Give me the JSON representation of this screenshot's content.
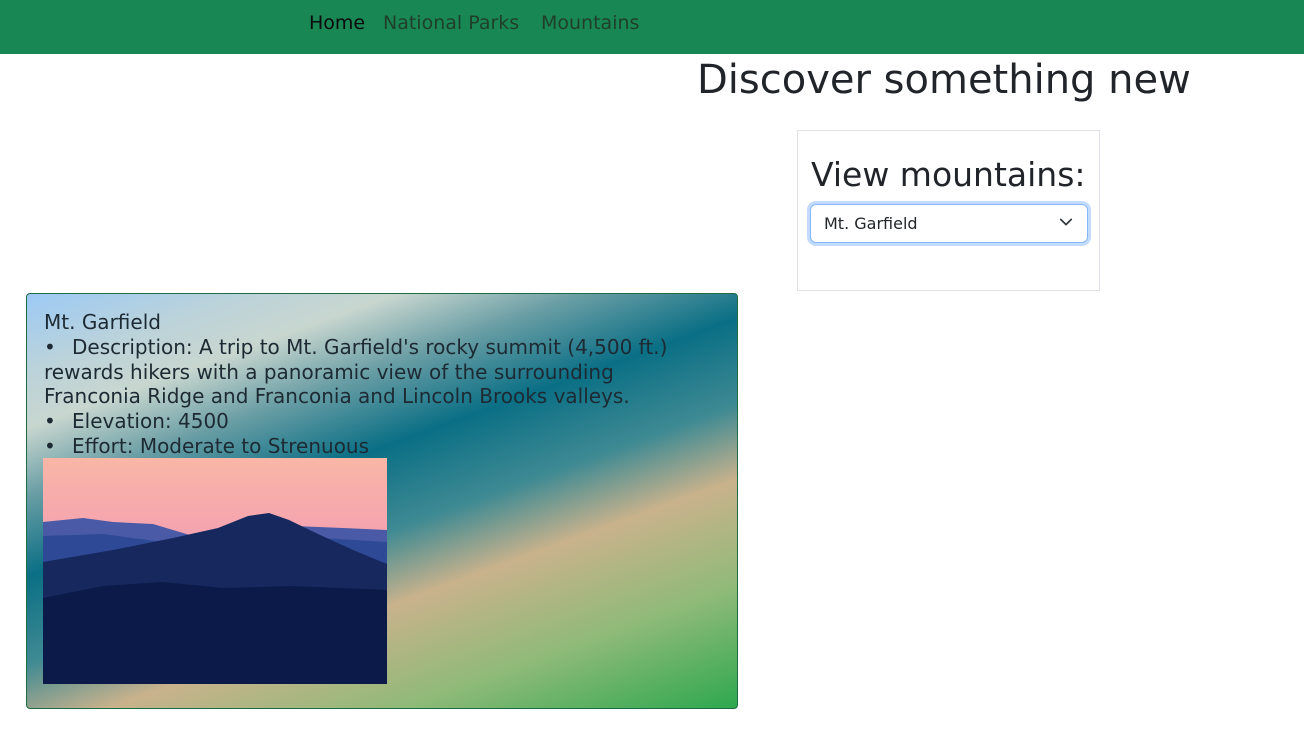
{
  "nav": {
    "items": [
      {
        "label": "Home"
      },
      {
        "label": "National Parks"
      },
      {
        "label": "Mountains"
      }
    ]
  },
  "heading": "Discover something new",
  "selector": {
    "label": "View mountains:",
    "selected": "Mt. Garfield"
  },
  "mountain": {
    "name": "Mt. Garfield",
    "description": "Description: A trip to Mt. Garfield's rocky summit (4,500 ft.) rewards hikers with a panoramic view of the surrounding Franconia Ridge and Franconia and Lincoln Brooks valleys.",
    "elevation": "Elevation: 4500",
    "effort": "Effort: Moderate to Strenuous"
  },
  "colors": {
    "navbar": "#198754",
    "focus_ring": "#86b7fe"
  },
  "icons": {
    "dropdown": "chevron-down-icon",
    "bullet": "bullet-icon"
  }
}
